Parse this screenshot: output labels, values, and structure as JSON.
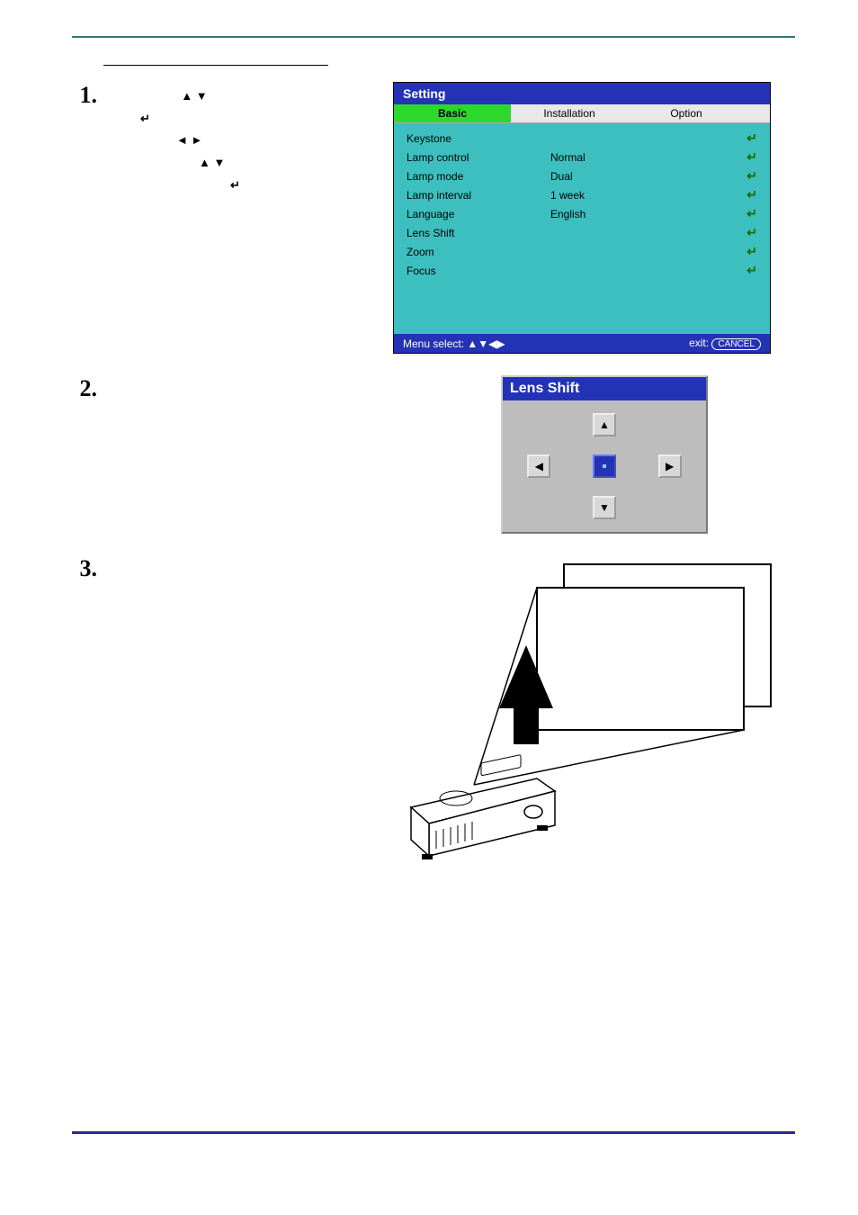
{
  "step1": {
    "number": "1.",
    "arrows_up_down": "▲ ▼",
    "enter_glyph": "↵",
    "arrows_left_right": "◄ ►",
    "arrows_up_down2": "▲ ▼",
    "enter_glyph2": "↵"
  },
  "step2": {
    "number": "2."
  },
  "step3": {
    "number": "3."
  },
  "menu": {
    "title": "Setting",
    "tabs": {
      "basic": "Basic",
      "installation": "Installation",
      "option": "Option"
    },
    "items": [
      {
        "label": "Keystone",
        "value": "",
        "enter": "↵"
      },
      {
        "label": "Lamp control",
        "value": "Normal",
        "enter": "↵"
      },
      {
        "label": "Lamp mode",
        "value": "Dual",
        "enter": "↵"
      },
      {
        "label": "Lamp interval",
        "value": "1 week",
        "enter": "↵"
      },
      {
        "label": "Language",
        "value": "English",
        "enter": "↵"
      },
      {
        "label": "Lens Shift",
        "value": "",
        "enter": "↵"
      },
      {
        "label": "Zoom",
        "value": "",
        "enter": "↵"
      },
      {
        "label": "Focus",
        "value": "",
        "enter": "↵"
      }
    ],
    "footer_left": "Menu select: ▲▼◀▶",
    "footer_exit": "exit:",
    "footer_cancel": "CANCEL"
  },
  "lens": {
    "title": "Lens Shift",
    "up": "▲",
    "down": "▼",
    "left": "◀",
    "right": "▶"
  }
}
